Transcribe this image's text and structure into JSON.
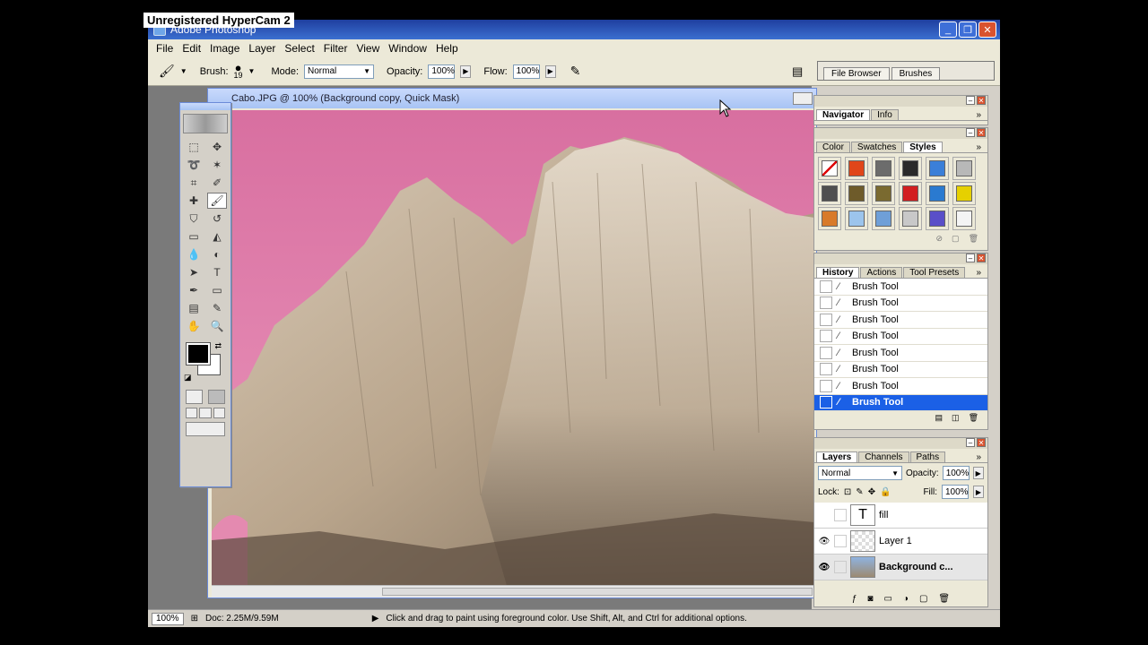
{
  "watermark": "Unregistered HyperCam 2",
  "app": {
    "title": "Adobe Photoshop"
  },
  "menu": [
    "File",
    "Edit",
    "Image",
    "Layer",
    "Select",
    "Filter",
    "View",
    "Window",
    "Help"
  ],
  "options": {
    "brush_label": "Brush:",
    "brush_size": "19",
    "mode_label": "Mode:",
    "mode_value": "Normal",
    "opacity_label": "Opacity:",
    "opacity_value": "100%",
    "flow_label": "Flow:",
    "flow_value": "100%"
  },
  "palette_well": {
    "tabs": [
      "File Browser",
      "Brushes"
    ]
  },
  "document": {
    "title": "Cabo.JPG @ 100% (Background copy, Quick Mask)"
  },
  "navigator": {
    "tabs": [
      "Navigator",
      "Info"
    ]
  },
  "styles": {
    "tabs": [
      "Color",
      "Swatches",
      "Styles"
    ],
    "swatch_colors": [
      "#ffffff",
      "#e0461a",
      "#6c6c6c",
      "#2a2a2a",
      "#3b7fd8",
      "#b8b8b8",
      "#4f4f4f",
      "#6e5b2a",
      "#7a6a30",
      "#d21f1f",
      "#2a7ad0",
      "#e6d000",
      "#d87a2a",
      "#9cc4ec",
      "#6f9fd8",
      "#c8c8c8",
      "#5a4fc8",
      "#f4f4f4"
    ]
  },
  "history": {
    "tabs": [
      "History",
      "Actions",
      "Tool Presets"
    ],
    "items": [
      "Brush Tool",
      "Brush Tool",
      "Brush Tool",
      "Brush Tool",
      "Brush Tool",
      "Brush Tool",
      "Brush Tool",
      "Brush Tool"
    ]
  },
  "layers": {
    "tabs": [
      "Layers",
      "Channels",
      "Paths"
    ],
    "blend_mode": "Normal",
    "opacity_label": "Opacity:",
    "opacity_value": "100%",
    "lock_label": "Lock:",
    "fill_label": "Fill:",
    "fill_value": "100%",
    "items": [
      {
        "name": "fill",
        "thumb": "T"
      },
      {
        "name": "Layer 1",
        "thumb": ""
      },
      {
        "name": "Background c...",
        "thumb": ""
      }
    ]
  },
  "status": {
    "zoom": "100%",
    "doc": "Doc: 2.25M/9.59M",
    "hint": "Click and drag to paint using foreground color.  Use Shift, Alt, and Ctrl for additional options."
  }
}
